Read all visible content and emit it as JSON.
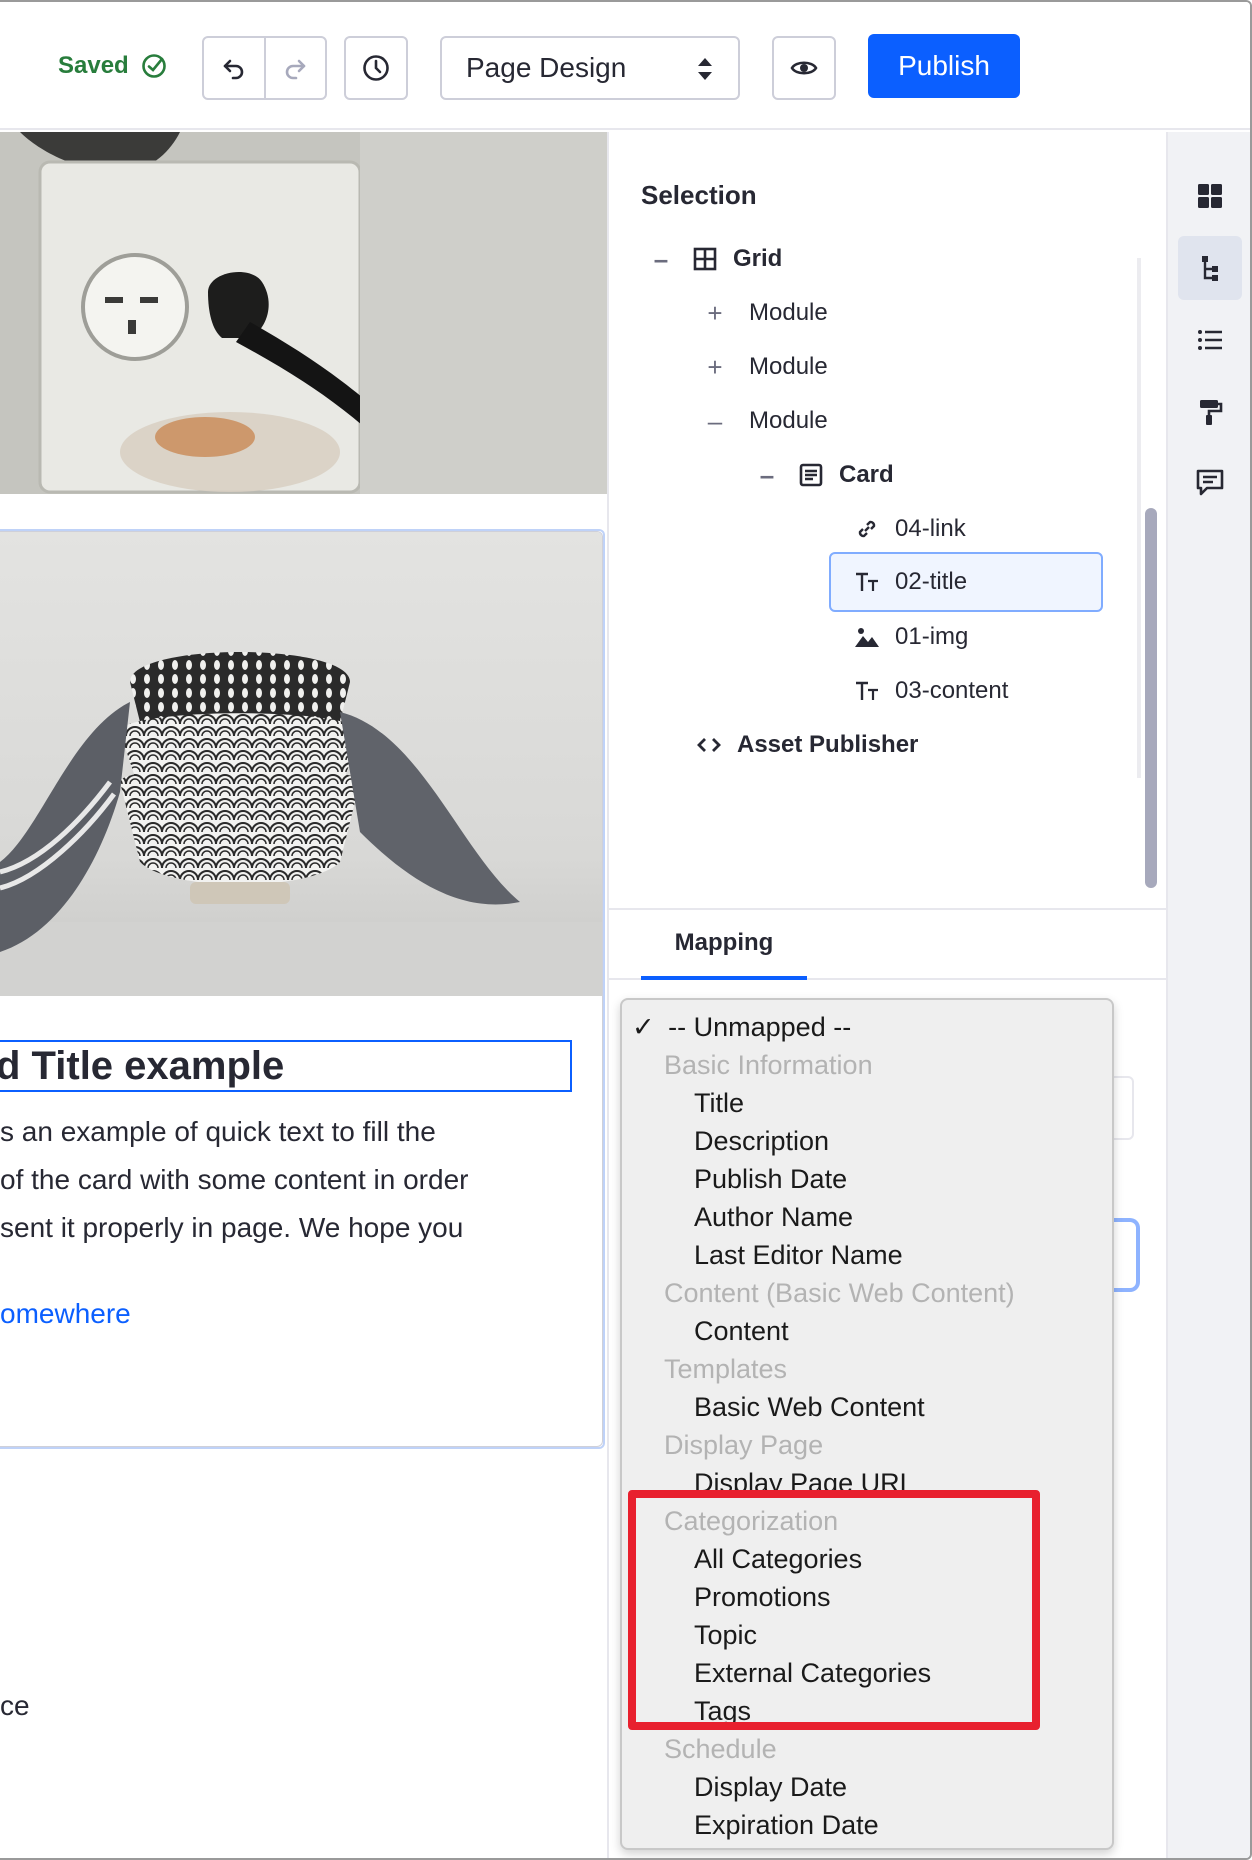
{
  "toolbar": {
    "saved_label": "Saved",
    "mode_select_value": "Page Design",
    "publish_label": "Publish"
  },
  "canvas": {
    "card_title": "d Title example",
    "card_body": "s an example of quick text to fill the\nof the card with some content in order\nsent it properly in page. We hope you",
    "card_link": "omewhere",
    "stray_text": "ce"
  },
  "panel": {
    "title": "Selection",
    "tree": [
      {
        "label": "Grid",
        "toggle": "–",
        "icon": "grid-icon"
      },
      {
        "label": "Module",
        "toggle": "+",
        "icon": ""
      },
      {
        "label": "Module",
        "toggle": "+",
        "icon": ""
      },
      {
        "label": "Module",
        "toggle": "–",
        "icon": ""
      },
      {
        "label": "Card",
        "toggle": "–",
        "icon": "card-icon"
      },
      {
        "label": "04-link",
        "toggle": "",
        "icon": "link-icon"
      },
      {
        "label": "02-title",
        "toggle": "",
        "icon": "text-icon"
      },
      {
        "label": "01-img",
        "toggle": "",
        "icon": "image-icon"
      },
      {
        "label": "03-content",
        "toggle": "",
        "icon": "text-icon"
      },
      {
        "label": "Asset Publisher",
        "toggle": "",
        "icon": "code-icon"
      }
    ],
    "tab_mapping": "Mapping"
  },
  "dropdown": {
    "selected": "-- Unmapped --",
    "check_mark": "✓",
    "options": [
      {
        "type": "group",
        "label": "Basic Information"
      },
      {
        "type": "item",
        "label": "Title"
      },
      {
        "type": "item",
        "label": "Description"
      },
      {
        "type": "item",
        "label": "Publish Date"
      },
      {
        "type": "item",
        "label": "Author Name"
      },
      {
        "type": "item",
        "label": "Last Editor Name"
      },
      {
        "type": "group",
        "label": "Content (Basic Web Content)"
      },
      {
        "type": "item",
        "label": "Content"
      },
      {
        "type": "group",
        "label": "Templates"
      },
      {
        "type": "item",
        "label": "Basic Web Content"
      },
      {
        "type": "group",
        "label": "Display Page"
      },
      {
        "type": "item",
        "label": "Display Page URL"
      },
      {
        "type": "group",
        "label": "Categorization"
      },
      {
        "type": "item",
        "label": "All Categories"
      },
      {
        "type": "item",
        "label": "Promotions"
      },
      {
        "type": "item",
        "label": "Topic"
      },
      {
        "type": "item",
        "label": "External Categories"
      },
      {
        "type": "item",
        "label": "Tags"
      },
      {
        "type": "group",
        "label": "Schedule"
      },
      {
        "type": "item",
        "label": "Display Date"
      },
      {
        "type": "item",
        "label": "Expiration Date"
      }
    ]
  },
  "colors": {
    "accent": "#0b5fff",
    "saved_green": "#287d3c",
    "highlight_red": "#e8202e"
  }
}
